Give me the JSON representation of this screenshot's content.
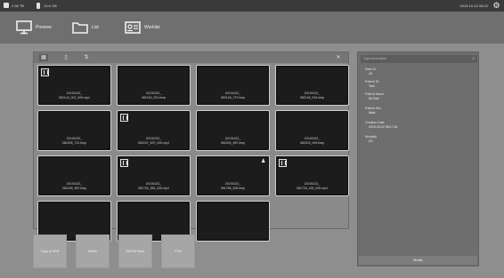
{
  "status_bar": {
    "usb_text": "2.56 TB",
    "battery_text": "13.6 GB",
    "datetime": "2019-10-22 08:22",
    "icons": [
      "usb-drive-icon",
      "battery-icon",
      "gear-icon"
    ]
  },
  "nav": {
    "preview": "Preview",
    "list": "List",
    "worklist": "Worklist"
  },
  "grid": {
    "toolbar_icons": [
      "grid-view-icon",
      "document-icon",
      "sort-icon",
      "close-icon"
    ],
    "thumbnails": [
      {
        "line1": "20191022_",
        "line2": "082144_001_000.mp4",
        "film": true,
        "person": false
      },
      {
        "line1": "20191022_",
        "line2": "082154_001.bmp",
        "film": false,
        "person": false
      },
      {
        "line1": "20191022_",
        "line2": "082148_737.bmp",
        "film": false,
        "person": false
      },
      {
        "line1": "20191022_",
        "line2": "082145_516.bmp",
        "film": false,
        "person": false
      },
      {
        "line1": "20191022_",
        "line2": "082205_721.bmp",
        "film": false,
        "person": false
      },
      {
        "line1": "20191022_",
        "line2": "082247_870_000.mp4",
        "film": true,
        "person": false
      },
      {
        "line1": "20191022_",
        "line2": "082200_987.bmp",
        "film": false,
        "person": false
      },
      {
        "line1": "20191022_",
        "line2": "082203_909.bmp",
        "film": false,
        "person": false
      },
      {
        "line1": "20191022_",
        "line2": "082248_987.bmp",
        "film": false,
        "person": false
      },
      {
        "line1": "20191022_",
        "line2": "081752_382_000.mp4",
        "film": true,
        "person": false
      },
      {
        "line1": "20191022_",
        "line2": "081755_525.bmp",
        "film": false,
        "person": true
      },
      {
        "line1": "20191022_",
        "line2": "081725_166_000.mp4",
        "film": true,
        "person": false
      },
      {
        "line1": "",
        "line2": "",
        "film": false,
        "person": false
      },
      {
        "line1": "",
        "line2": "",
        "film": false,
        "person": false
      },
      {
        "line1": "",
        "line2": "",
        "film": false,
        "person": false
      }
    ]
  },
  "actions": {
    "copy_to_usb": "Copy to USB",
    "delete": "Delete",
    "dicom_store": "DICOM Store",
    "print": "Print"
  },
  "info": {
    "search_placeholder": "Type information",
    "fields": [
      {
        "label": "Date ID",
        "value": "16"
      },
      {
        "label": "Patient ID",
        "value": "Test"
      },
      {
        "label": "Patient Name",
        "value": "Mr Doe"
      },
      {
        "label": "Patient Sex",
        "value": "Male"
      },
      {
        "label": "Creation Date",
        "value": "2019-10-22 08:17:24"
      },
      {
        "label": "Modality",
        "value": "ES"
      }
    ],
    "modify": "Modify"
  }
}
